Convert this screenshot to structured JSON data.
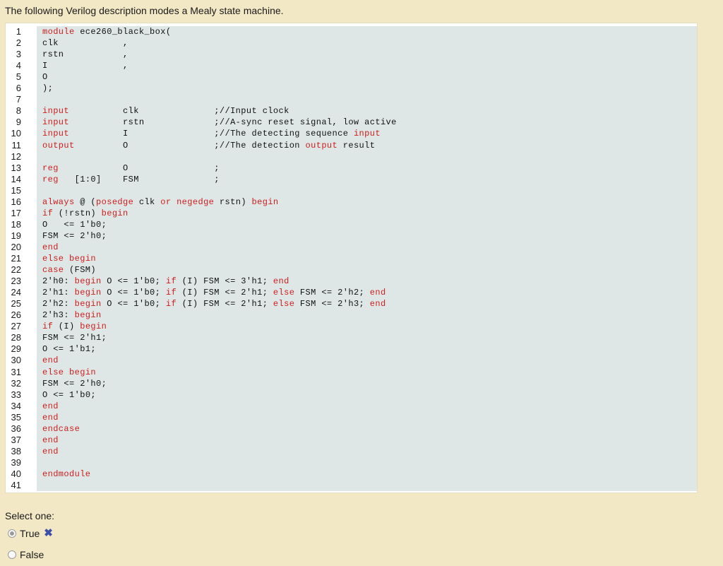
{
  "question": {
    "text": "The following Verilog description modes a Mealy state machine."
  },
  "code": {
    "lines": [
      {
        "n": "1",
        "t": "module ece260_black_box("
      },
      {
        "n": "2",
        "t": "clk            ,"
      },
      {
        "n": "3",
        "t": "rstn           ,"
      },
      {
        "n": "4",
        "t": "I              ,"
      },
      {
        "n": "5",
        "t": "O"
      },
      {
        "n": "6",
        "t": ");"
      },
      {
        "n": "7",
        "t": ""
      },
      {
        "n": "8",
        "t": "input          clk              ;//Input clock"
      },
      {
        "n": "9",
        "t": "input          rstn             ;//A-sync reset signal, low active"
      },
      {
        "n": "10",
        "t": "input          I                ;//The detecting sequence input"
      },
      {
        "n": "11",
        "t": "output         O                ;//The detection output result"
      },
      {
        "n": "12",
        "t": ""
      },
      {
        "n": "13",
        "t": "reg            O                ;"
      },
      {
        "n": "14",
        "t": "reg   [1:0]    FSM              ;"
      },
      {
        "n": "15",
        "t": ""
      },
      {
        "n": "16",
        "t": "always @ (posedge clk or negedge rstn) begin"
      },
      {
        "n": "17",
        "t": "if (!rstn) begin"
      },
      {
        "n": "18",
        "t": "O   <= 1'b0;"
      },
      {
        "n": "19",
        "t": "FSM <= 2'h0;"
      },
      {
        "n": "20",
        "t": "end"
      },
      {
        "n": "21",
        "t": "else begin"
      },
      {
        "n": "22",
        "t": "case (FSM)"
      },
      {
        "n": "23",
        "t": "2'h0: begin O <= 1'b0; if (I) FSM <= 3'h1; end"
      },
      {
        "n": "24",
        "t": "2'h1: begin O <= 1'b0; if (I) FSM <= 2'h1; else FSM <= 2'h2; end"
      },
      {
        "n": "25",
        "t": "2'h2: begin O <= 1'b0; if (I) FSM <= 2'h1; else FSM <= 2'h3; end"
      },
      {
        "n": "26",
        "t": "2'h3: begin"
      },
      {
        "n": "27",
        "t": "if (I) begin"
      },
      {
        "n": "28",
        "t": "FSM <= 2'h1;"
      },
      {
        "n": "29",
        "t": "O <= 1'b1;"
      },
      {
        "n": "30",
        "t": "end"
      },
      {
        "n": "31",
        "t": "else begin"
      },
      {
        "n": "32",
        "t": "FSM <= 2'h0;"
      },
      {
        "n": "33",
        "t": "O <= 1'b0;"
      },
      {
        "n": "34",
        "t": "end"
      },
      {
        "n": "35",
        "t": "end"
      },
      {
        "n": "36",
        "t": "endcase"
      },
      {
        "n": "37",
        "t": "end"
      },
      {
        "n": "38",
        "t": "end"
      },
      {
        "n": "39",
        "t": ""
      },
      {
        "n": "40",
        "t": "endmodule"
      },
      {
        "n": "41",
        "t": ""
      }
    ],
    "keywords": [
      "module",
      "input",
      "output",
      "reg",
      "always",
      "posedge",
      "or",
      "negedge",
      "begin",
      "end",
      "if",
      "else",
      "case",
      "endcase",
      "endmodule"
    ],
    "colors": {
      "keyword": "#cc1e1e",
      "background": "#dfe7e6"
    }
  },
  "answer": {
    "select_label": "Select one:",
    "options": [
      {
        "label": "True",
        "selected": true,
        "marked_incorrect": true,
        "mark_icon": "x-icon"
      },
      {
        "label": "False",
        "selected": false
      }
    ]
  }
}
